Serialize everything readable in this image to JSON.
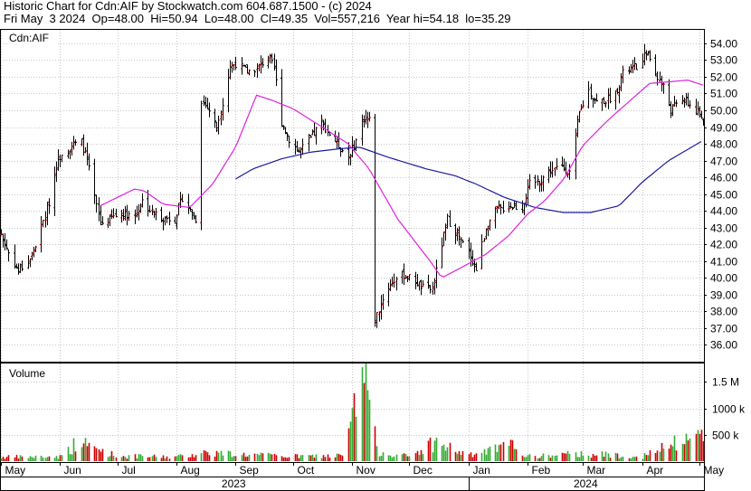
{
  "header": {
    "line1": "Historic Chart for Cdn:AIF by Stockwatch.com 604.687.1500 - (c) 2024",
    "line2": "Fri May  3 2024  Op=48.00  Hi=50.94  Lo=48.00  Cl=49.35  Vol=557,216  Year hi=54.18  lo=35.29"
  },
  "price_panel": {
    "label": "Cdn:AIF"
  },
  "volume_panel": {
    "label": "Volume"
  },
  "colors": {
    "up_bar": "#cc0000",
    "down_bar": "#000000",
    "ma_short": "#dd22dd",
    "ma_long": "#1a1aa0",
    "volume_up": "#33aa33",
    "volume_down": "#cc0000"
  },
  "chart_data": {
    "type": "bar",
    "subtype": "ohlc",
    "price_axis": {
      "ylim": [
        35.0,
        54.8
      ],
      "ticks": [
        "36.00",
        "37.00",
        "38.00",
        "39.00",
        "40.00",
        "41.00",
        "42.00",
        "43.00",
        "44.00",
        "45.00",
        "46.00",
        "47.00",
        "48.00",
        "49.00",
        "50.00",
        "51.00",
        "52.00",
        "53.00",
        "54.00"
      ]
    },
    "volume_axis": {
      "ylim": [
        0,
        1850000
      ],
      "ticks": [
        {
          "value": 500000,
          "label": "500 k"
        },
        {
          "value": 1000000,
          "label": "1000 k"
        },
        {
          "value": 1500000,
          "label": "1.5 M"
        }
      ]
    },
    "x_axis": {
      "start": "2023-05-01",
      "end": "2024-05-03",
      "months": [
        {
          "label": "May",
          "date": "2023-05-01"
        },
        {
          "label": "Jun",
          "date": "2023-06-01"
        },
        {
          "label": "Jul",
          "date": "2023-07-01"
        },
        {
          "label": "Aug",
          "date": "2023-08-01"
        },
        {
          "label": "Sep",
          "date": "2023-09-01"
        },
        {
          "label": "Oct",
          "date": "2023-10-01"
        },
        {
          "label": "Nov",
          "date": "2023-11-01"
        },
        {
          "label": "Dec",
          "date": "2023-12-01"
        },
        {
          "label": "Jan",
          "date": "2024-01-01"
        },
        {
          "label": "Feb",
          "date": "2024-02-01"
        },
        {
          "label": "Mar",
          "date": "2024-03-01"
        },
        {
          "label": "Apr",
          "date": "2024-04-01"
        },
        {
          "label": "May",
          "date": "2024-05-01"
        }
      ],
      "years": [
        {
          "label": "2023",
          "from": "2023-05-01",
          "to": "2023-12-31"
        },
        {
          "label": "2024",
          "from": "2024-01-01",
          "to": "2024-05-03"
        }
      ]
    },
    "price_anchors": [
      [
        "2023-05-01",
        42.6
      ],
      [
        "2023-05-05",
        41.5
      ],
      [
        "2023-05-10",
        40.4
      ],
      [
        "2023-05-17",
        41.3
      ],
      [
        "2023-05-22",
        43.0
      ],
      [
        "2023-05-26",
        44.5
      ],
      [
        "2023-05-30",
        46.8
      ],
      [
        "2023-06-02",
        47.5
      ],
      [
        "2023-06-07",
        47.9
      ],
      [
        "2023-06-12",
        48.1
      ],
      [
        "2023-06-15",
        47.0
      ],
      [
        "2023-06-19",
        44.8
      ],
      [
        "2023-06-22",
        43.2
      ],
      [
        "2023-06-28",
        43.6
      ],
      [
        "2023-07-04",
        43.9
      ],
      [
        "2023-07-10",
        43.7
      ],
      [
        "2023-07-14",
        44.6
      ],
      [
        "2023-07-19",
        43.9
      ],
      [
        "2023-07-25",
        43.6
      ],
      [
        "2023-07-31",
        43.5
      ],
      [
        "2023-08-04",
        44.8
      ],
      [
        "2023-08-08",
        44.0
      ],
      [
        "2023-08-11",
        43.5
      ],
      [
        "2023-08-14",
        50.6
      ],
      [
        "2023-08-18",
        50.0
      ],
      [
        "2023-08-22",
        49.0
      ],
      [
        "2023-08-25",
        50.5
      ],
      [
        "2023-08-29",
        52.6
      ],
      [
        "2023-09-01",
        52.8
      ],
      [
        "2023-09-07",
        52.3
      ],
      [
        "2023-09-13",
        52.6
      ],
      [
        "2023-09-18",
        53.2
      ],
      [
        "2023-09-21",
        52.5
      ],
      [
        "2023-09-25",
        49.3
      ],
      [
        "2023-09-29",
        48.3
      ],
      [
        "2023-10-04",
        47.5
      ],
      [
        "2023-10-10",
        48.3
      ],
      [
        "2023-10-16",
        49.3
      ],
      [
        "2023-10-20",
        48.6
      ],
      [
        "2023-10-25",
        47.9
      ],
      [
        "2023-10-30",
        47.2
      ],
      [
        "2023-11-03",
        48.2
      ],
      [
        "2023-11-07",
        49.6
      ],
      [
        "2023-11-10",
        49.4
      ],
      [
        "2023-11-13",
        37.5
      ],
      [
        "2023-11-17",
        38.8
      ],
      [
        "2023-11-22",
        39.8
      ],
      [
        "2023-11-28",
        40.2
      ],
      [
        "2023-12-04",
        39.8
      ],
      [
        "2023-12-08",
        39.4
      ],
      [
        "2023-12-13",
        39.3
      ],
      [
        "2023-12-18",
        42.0
      ],
      [
        "2023-12-21",
        43.5
      ],
      [
        "2023-12-27",
        42.4
      ],
      [
        "2024-01-02",
        41.3
      ],
      [
        "2024-01-05",
        40.5
      ],
      [
        "2024-01-10",
        43.0
      ],
      [
        "2024-01-15",
        44.0
      ],
      [
        "2024-01-22",
        44.3
      ],
      [
        "2024-01-29",
        44.2
      ],
      [
        "2024-02-02",
        45.6
      ],
      [
        "2024-02-07",
        45.8
      ],
      [
        "2024-02-13",
        46.4
      ],
      [
        "2024-02-19",
        46.6
      ],
      [
        "2024-02-23",
        46.3
      ],
      [
        "2024-02-28",
        49.8
      ],
      [
        "2024-03-04",
        51.2
      ],
      [
        "2024-03-08",
        50.5
      ],
      [
        "2024-03-13",
        50.6
      ],
      [
        "2024-03-18",
        51.0
      ],
      [
        "2024-03-22",
        52.2
      ],
      [
        "2024-03-27",
        52.5
      ],
      [
        "2024-04-01",
        52.8
      ],
      [
        "2024-04-03",
        53.6
      ],
      [
        "2024-04-08",
        52.2
      ],
      [
        "2024-04-12",
        51.4
      ],
      [
        "2024-04-16",
        50.0
      ],
      [
        "2024-04-22",
        50.7
      ],
      [
        "2024-04-26",
        50.3
      ],
      [
        "2024-05-03",
        49.35
      ]
    ],
    "ma_short_anchors": [
      [
        "2023-06-22",
        44.3
      ],
      [
        "2023-07-01",
        44.8
      ],
      [
        "2023-07-10",
        45.3
      ],
      [
        "2023-07-15",
        45.2
      ],
      [
        "2023-07-25",
        44.4
      ],
      [
        "2023-08-08",
        44.2
      ],
      [
        "2023-08-20",
        45.6
      ],
      [
        "2023-09-01",
        47.8
      ],
      [
        "2023-09-12",
        50.9
      ],
      [
        "2023-09-20",
        50.6
      ],
      [
        "2023-10-01",
        50.1
      ],
      [
        "2023-10-15",
        49.1
      ],
      [
        "2023-10-30",
        48.0
      ],
      [
        "2023-11-10",
        46.5
      ],
      [
        "2023-11-25",
        43.5
      ],
      [
        "2023-12-12",
        41.0
      ],
      [
        "2023-12-18",
        40.0
      ],
      [
        "2023-12-28",
        40.6
      ],
      [
        "2024-01-10",
        41.4
      ],
      [
        "2024-01-22",
        42.5
      ],
      [
        "2024-02-01",
        43.8
      ],
      [
        "2024-02-10",
        44.6
      ],
      [
        "2024-02-20",
        45.9
      ],
      [
        "2024-03-01",
        47.9
      ],
      [
        "2024-03-15",
        49.5
      ],
      [
        "2024-03-28",
        50.8
      ],
      [
        "2024-04-05",
        51.6
      ],
      [
        "2024-04-15",
        51.7
      ],
      [
        "2024-04-25",
        51.8
      ],
      [
        "2024-05-03",
        51.5
      ]
    ],
    "ma_long_anchors": [
      [
        "2023-09-01",
        45.9
      ],
      [
        "2023-09-10",
        46.5
      ],
      [
        "2023-09-25",
        47.1
      ],
      [
        "2023-10-10",
        47.5
      ],
      [
        "2023-10-25",
        47.7
      ],
      [
        "2023-11-05",
        47.8
      ],
      [
        "2023-11-20",
        47.2
      ],
      [
        "2023-12-10",
        46.5
      ],
      [
        "2023-12-25",
        46.1
      ],
      [
        "2024-01-05",
        45.6
      ],
      [
        "2024-01-20",
        44.8
      ],
      [
        "2024-02-05",
        44.2
      ],
      [
        "2024-02-20",
        43.9
      ],
      [
        "2024-03-05",
        43.9
      ],
      [
        "2024-03-20",
        44.3
      ],
      [
        "2024-04-01",
        45.7
      ],
      [
        "2024-04-15",
        47.0
      ],
      [
        "2024-05-03",
        48.2
      ]
    ],
    "volume_anchors": [
      [
        "2023-05-01",
        80000
      ],
      [
        "2023-06-01",
        90000
      ],
      [
        "2023-06-10",
        380000
      ],
      [
        "2023-07-01",
        100000
      ],
      [
        "2023-08-01",
        85000
      ],
      [
        "2023-08-16",
        180000
      ],
      [
        "2023-09-01",
        140000
      ],
      [
        "2023-10-01",
        95000
      ],
      [
        "2023-10-27",
        110000
      ],
      [
        "2023-11-08",
        1850000
      ],
      [
        "2023-11-14",
        200000
      ],
      [
        "2023-12-01",
        90000
      ],
      [
        "2023-12-14",
        380000
      ],
      [
        "2024-01-01",
        110000
      ],
      [
        "2024-01-25",
        320000
      ],
      [
        "2024-02-01",
        90000
      ],
      [
        "2024-03-01",
        150000
      ],
      [
        "2024-04-01",
        95000
      ],
      [
        "2024-05-03",
        557216
      ]
    ]
  }
}
